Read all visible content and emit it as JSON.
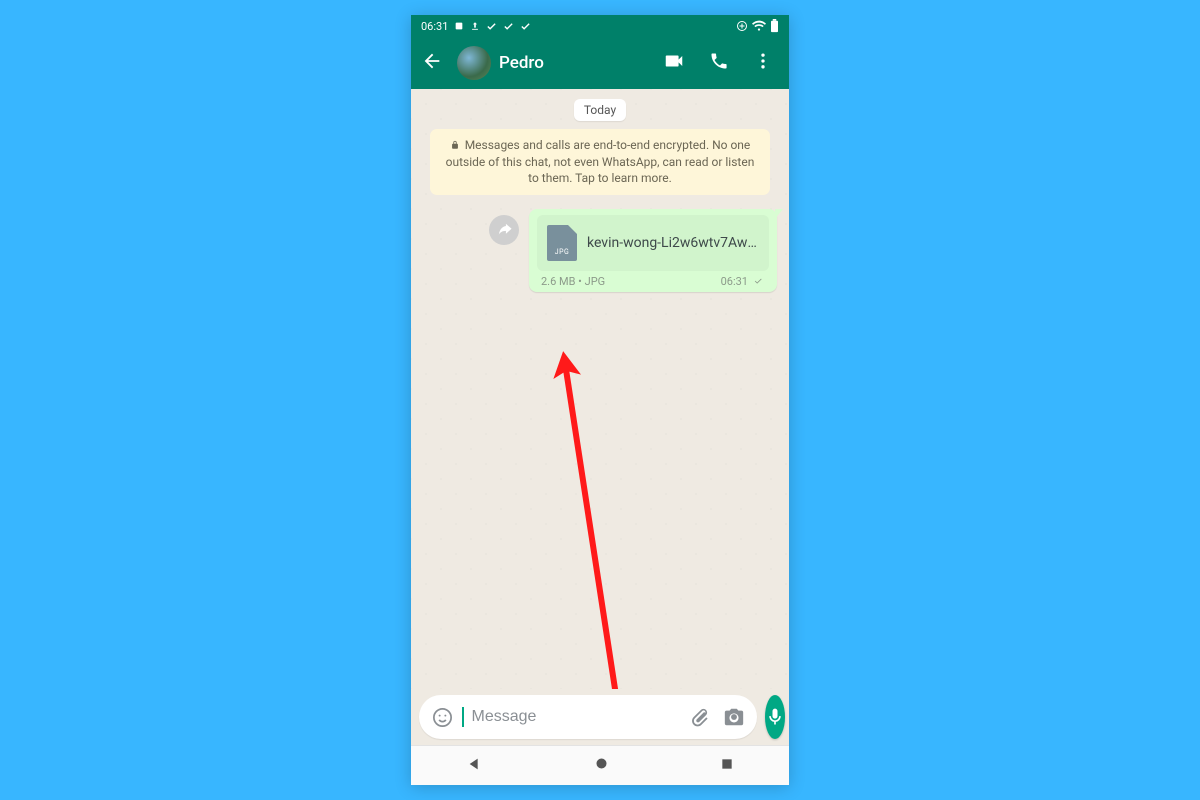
{
  "statusbar": {
    "time": "06:31"
  },
  "header": {
    "contact_name": "Pedro"
  },
  "chat": {
    "date_label": "Today",
    "encryption_notice": "Messages and calls are end-to-end encrypted. No one outside of this chat, not even WhatsApp, can read or listen to them. Tap to learn more.",
    "message": {
      "file_ext_badge": "JPG",
      "filename": "kevin-wong-Li2w6wtv7Aw-…",
      "size": "2.6 MB",
      "type": "JPG",
      "time": "06:31"
    }
  },
  "composer": {
    "placeholder": "Message"
  },
  "colors": {
    "brand_green": "#008069",
    "accent_green": "#00a884",
    "bubble": "#d9fdd3"
  }
}
